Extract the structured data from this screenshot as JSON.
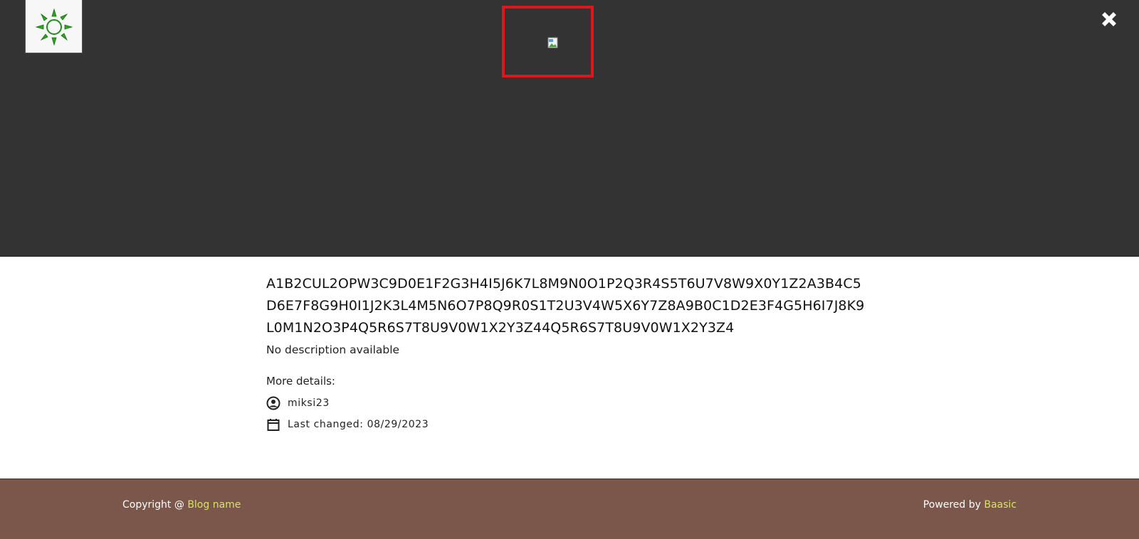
{
  "header": {
    "logo_icon": "sun-logo-icon",
    "close_icon": "close-icon",
    "image_frame_color": "#e2151d",
    "background": "#333333"
  },
  "post": {
    "title": "A1B2CUL2OPW3C9D0E1F2G3H4I5J6K7L8M9N0O1P2Q3R4S5T6U7V8W9X0Y1Z2A3B4C5D6E7F8G9H0I1J2K3L4M5N6O7P8Q9R0S1T2U3V4W5X6Y7Z8A9B0C1D2E3F4G5H6I7J8K9L0M1N2O3P4Q5R6S7T8U9V0W1X2Y3Z44Q5R6S7T8U9V0W1X2Y3Z4",
    "description": "No description available",
    "details_label": "More details:",
    "author": "miksi23",
    "last_changed": "Last changed: 08/29/2023"
  },
  "footer": {
    "copyright_prefix": "Copyright @ ",
    "blog_link": "Blog name",
    "powered_prefix": "Powered by ",
    "powered_link": "Baasic",
    "background": "#7b564a",
    "link_color": "#d6e36a"
  }
}
